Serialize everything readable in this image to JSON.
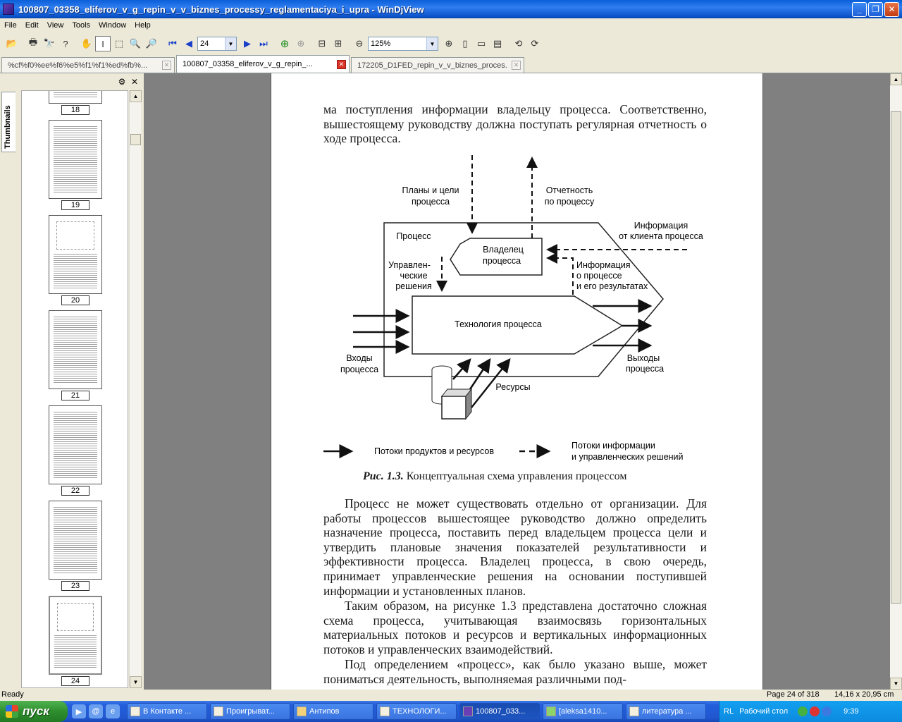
{
  "window": {
    "title": "100807_03358_eliferov_v_g_repin_v_v_biznes_processy_reglamentaciya_i_upra - WinDjView",
    "minimize": "_",
    "maximize": "❐",
    "close": "✕"
  },
  "menu": [
    "File",
    "Edit",
    "View",
    "Tools",
    "Window",
    "Help"
  ],
  "toolbar": {
    "page_value": "24",
    "zoom_value": "125%"
  },
  "tabs": [
    {
      "label": "%cf%f0%ee%f6%e5%f1%f1%ed%fb%..."
    },
    {
      "label": "100807_03358_eliferov_v_g_repin_..."
    },
    {
      "label": "172205_D1FED_repin_v_v_biznes_proces..."
    }
  ],
  "sidebar": {
    "tab_label": "Thumbnails",
    "settings_icon": "⚙",
    "close_icon": "✕",
    "thumbnails": [
      "18",
      "19",
      "20",
      "21",
      "22",
      "23",
      "24"
    ]
  },
  "document": {
    "para_top": "ма поступления информации владельцу процесса. Соответственно, вышестоящему руководству должна поступать регулярная отчетность о ходе процесса.",
    "diagram": {
      "plans": "Планы и цели",
      "plans2": "процесса",
      "report": "Отчетность",
      "report2": "по процессу",
      "info_client": "Информация",
      "info_client2": "от клиента процесса",
      "process": "Процесс",
      "owner": "Владелец",
      "owner2": "процесса",
      "mgmt1": "Управлен-",
      "mgmt2": "ческие",
      "mgmt3": "решения",
      "info_proc1": "Информация",
      "info_proc2": "о процессе",
      "info_proc3": "и его результатах",
      "tech": "Технология процесса",
      "inputs1": "Входы",
      "inputs2": "процесса",
      "outputs1": "Выходы",
      "outputs2": "процесса",
      "resources": "Ресурсы",
      "legend_solid": "Потоки продуктов и ресурсов",
      "legend_dash1": "Потоки информации",
      "legend_dash2": "и управленческих решений"
    },
    "caption_label": "Рис. 1.3.",
    "caption_text": "Концептуальная схема управления процессом",
    "para1": "Процесс не может существовать отдельно от организации. Для работы процессов вышестоящее руководство должно определить назначение процесса, поставить перед владельцем процесса цели и утвердить плановые значения показателей результативности и эффективности процесса. Владелец процесса, в свою очередь, принимает управленческие решения на основании поступившей информации и установленных планов.",
    "para2": "Таким образом, на рисунке 1.3 представлена достаточно сложная схема процесса, учитывающая взаимосвязь горизонтальных материальных потоков и ресурсов и вертикальных информационных потоков и управленческих взаимодействий.",
    "para3": "Под определением «процесс», как было указано выше, может пониматься деятельность, выполняемая различными под-"
  },
  "status": {
    "left": "Ready",
    "page": "Page 24 of 318",
    "size": "14,16 x 20,95 cm"
  },
  "taskbar": {
    "start": "пуск",
    "tasks": [
      "В Контакте ...",
      "Проигрыват...",
      "Антипов",
      "ТЕХНОЛОГИ...",
      "100807_033...",
      "[aleksa1410...",
      "литература ..."
    ],
    "tray_lang": "RL",
    "tray_desktop": "Рабочий стол",
    "clock": "9:39"
  }
}
